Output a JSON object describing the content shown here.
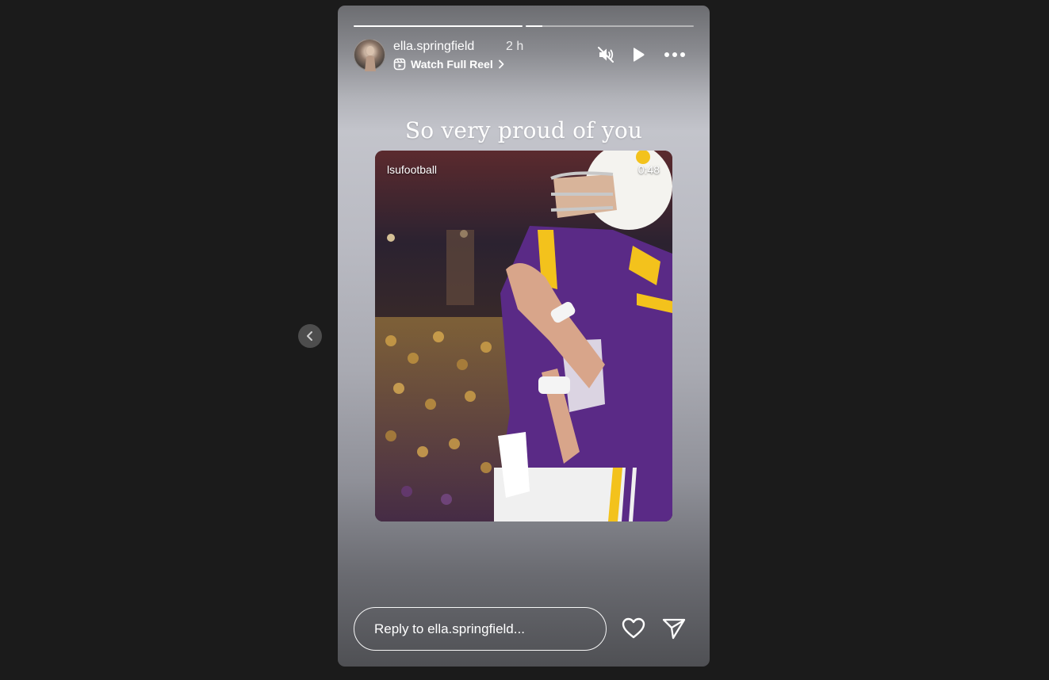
{
  "story": {
    "progress": [
      {
        "segment": 1,
        "fill_fraction": 1.0
      },
      {
        "segment": 2,
        "fill_fraction": 0.1
      }
    ],
    "header": {
      "username": "ella.springfield",
      "time_ago": "2 h",
      "reel_link_label": "Watch Full Reel",
      "icons": [
        "muted-speaker-icon",
        "play-icon",
        "more-options-icon"
      ]
    },
    "caption": "So very proud of you",
    "reel": {
      "handle": "lsufootball",
      "duration": "0:48"
    },
    "footer": {
      "reply_placeholder": "Reply to ella.springfield...",
      "icons": [
        "heart-icon",
        "send-icon"
      ]
    }
  },
  "navigation": {
    "prev_icon": "chevron-left-icon"
  },
  "colors": {
    "page_background": "#1b1b1b",
    "jersey_purple": "#5a2a86",
    "jersey_gold": "#f3c21c"
  }
}
